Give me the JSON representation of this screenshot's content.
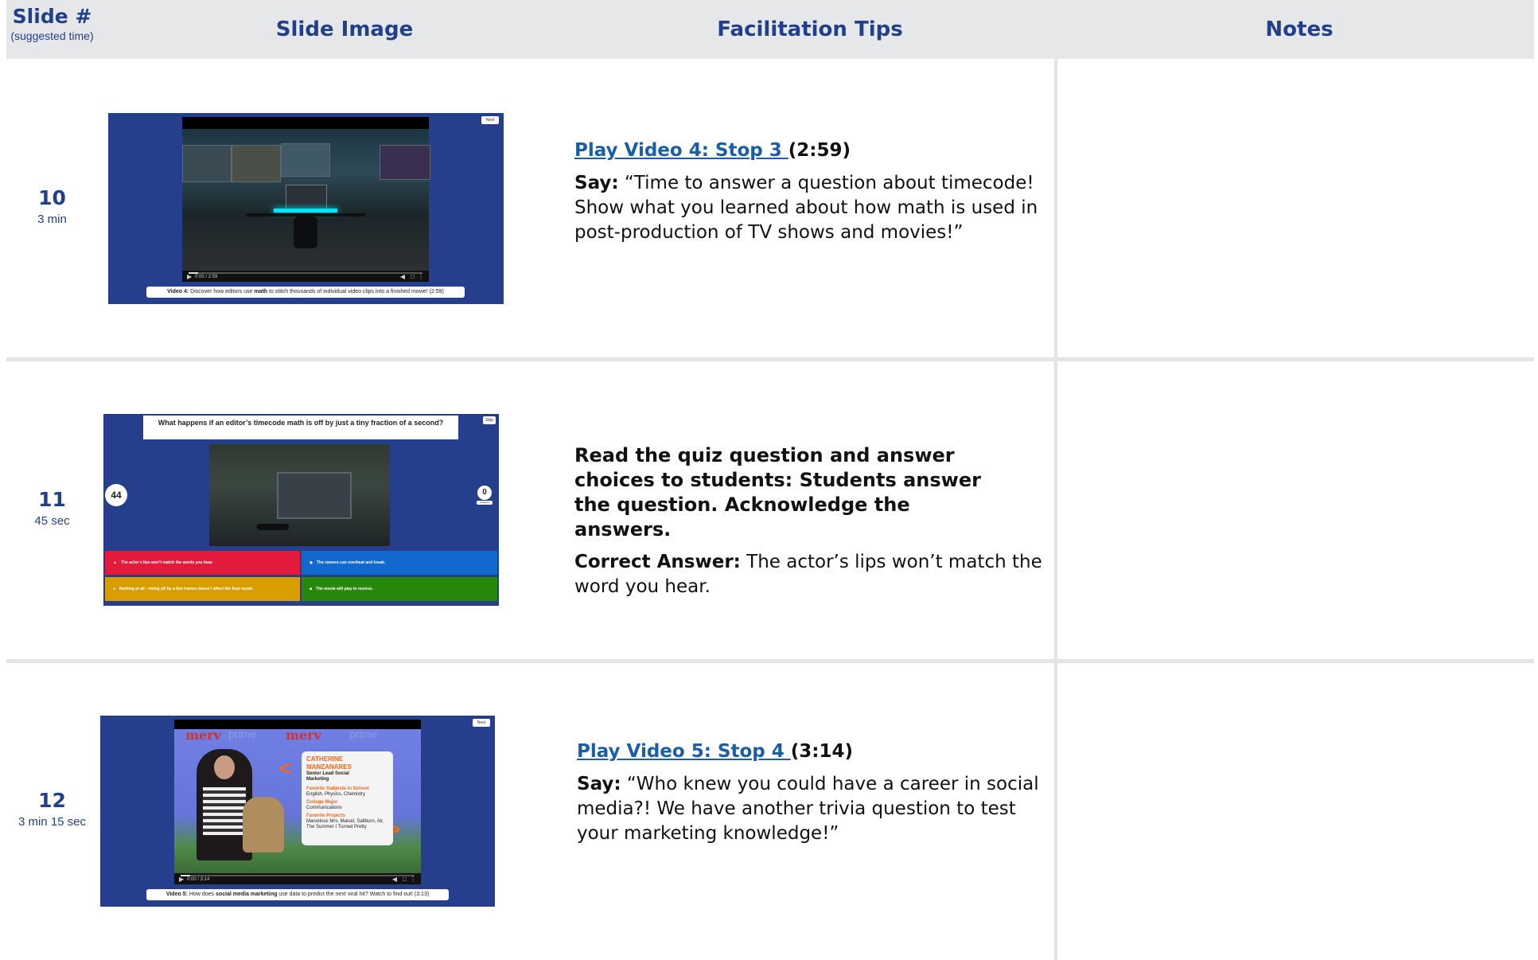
{
  "header": {
    "slide_label": "Slide #",
    "slide_sub": "(suggested time)",
    "image_label": "Slide Image",
    "tips_label": "Facilitation Tips",
    "notes_label": "Notes"
  },
  "rows": [
    {
      "number": "10",
      "duration": "3 min",
      "link": "Play Video 4: Stop 3 ",
      "link_time": "(2:59)",
      "say_label": "Say:",
      "say_text": " “Time to answer a question about timecode! Show what you learned about how math is used in post-production of TV shows and movies!”",
      "slide": {
        "next_label": "Next",
        "player_time": "0:00 / 2:59",
        "caption_prefix": "Video 4:",
        "caption_a": " Discover how editors use ",
        "caption_bold": "math",
        "caption_b": " to stitch thousands of individual video clips into a finished movie! (2:59)"
      }
    },
    {
      "number": "11",
      "duration": "45 sec",
      "instruction": "Read the quiz question and answer choices to students: Students answer the question. Acknowledge the answers.",
      "answer_label": "Correct Answer:",
      "answer_text": " The actor’s lips won’t match the word you hear.",
      "slide": {
        "skip_label": "Skip",
        "question_a": "What happens if an editor’s ",
        "question_bold": "timecode",
        "question_b": " math is off by just a tiny fraction of a second?",
        "timer": "44",
        "answers_count": "0",
        "answers_label": "Answers",
        "choices": [
          {
            "icon": "triangle",
            "text": "The actor’s lips won’t match the words you hear.",
            "color": "#e21b3c"
          },
          {
            "icon": "diamond",
            "text": "The camera can overheat and break.",
            "color": "#1368ce"
          },
          {
            "icon": "circle",
            "text": "Nothing at all – being off by a few frames doesn’t affect the final movie.",
            "color": "#d89e00"
          },
          {
            "icon": "square",
            "text": "The movie will play in reverse.",
            "color": "#26890c"
          }
        ]
      }
    },
    {
      "number": "12",
      "duration": "3 min 15 sec",
      "link": "Play Video 5: Stop 4 ",
      "link_time": "(3:14)",
      "say_label": "Say:",
      "say_text": " “Who knew you could have a career in social media?! We have another trivia question to test your marketing knowledge!”",
      "slide": {
        "next_label": "Next",
        "player_time": "0:00 / 3:14",
        "brand_a": "merv",
        "brand_b": "prime",
        "card_name": "CATHERINE MANZANARES",
        "card_role": "Senior Lead Social Marketing",
        "card_h1": "Favorite Subjects in School",
        "card_t1": "English, Physics, Chemistry",
        "card_h2": "College Major",
        "card_t2": "Communications",
        "card_h3": "Favorite Projects",
        "card_t3": "Marvelous Mrs. Maisel, Saltburn, Air, The Summer I Turned Pretty",
        "caption_prefix": "Video 5:",
        "caption_a": " How does ",
        "caption_bold": "social media marketing",
        "caption_b": " use data to predict the next viral hit? Watch to find out! (3:13)"
      }
    }
  ],
  "colors": {
    "header_bg": "#e6e7e9",
    "heading_blue": "#213f8a",
    "link_blue": "#1a5ea8",
    "slide_bg": "#253f8d"
  }
}
